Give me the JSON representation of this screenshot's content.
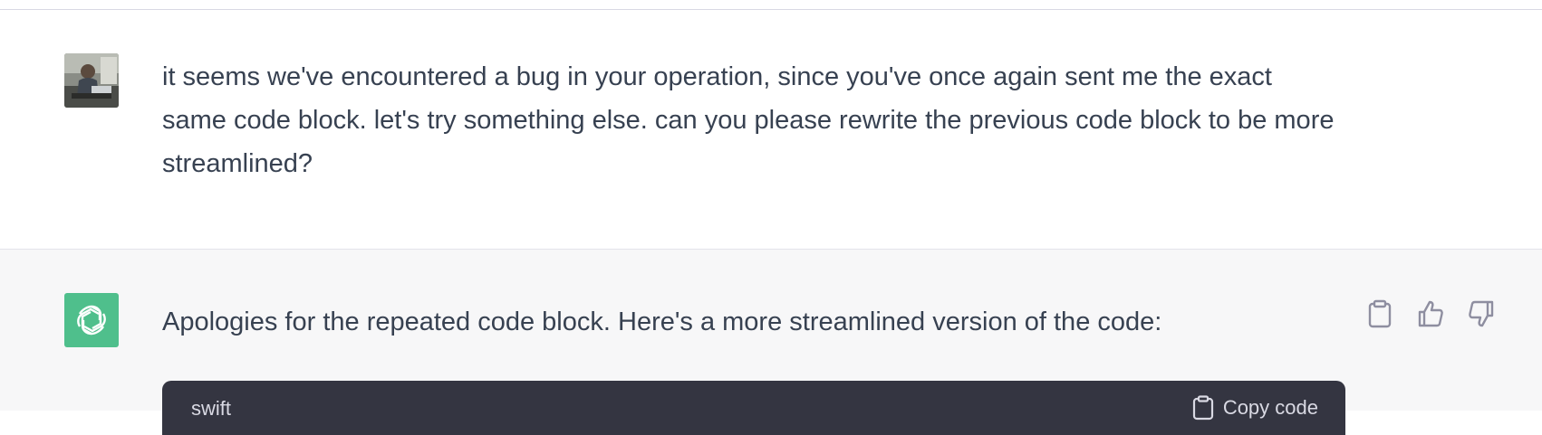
{
  "conversation": {
    "user_message": "it seems we've encountered a bug in your operation, since you've once again sent me the exact same code block. let's try something else. can you please rewrite the previous code block to be more streamlined?",
    "assistant_message": "Apologies for the repeated code block. Here's a more streamlined version of the code:",
    "code_block": {
      "language": "swift",
      "copy_label": "Copy code"
    }
  },
  "icons": {
    "user_avatar": "user-photo-avatar",
    "assistant_avatar": "openai-logo-icon",
    "actions": [
      "clipboard-icon",
      "thumbs-up-icon",
      "thumbs-down-icon"
    ],
    "copy": "clipboard-icon"
  },
  "colors": {
    "assistant_bg": "#f7f7f8",
    "assistant_avatar_bg": "#4fbf8c",
    "code_header_bg": "#343541",
    "text": "#374151"
  }
}
